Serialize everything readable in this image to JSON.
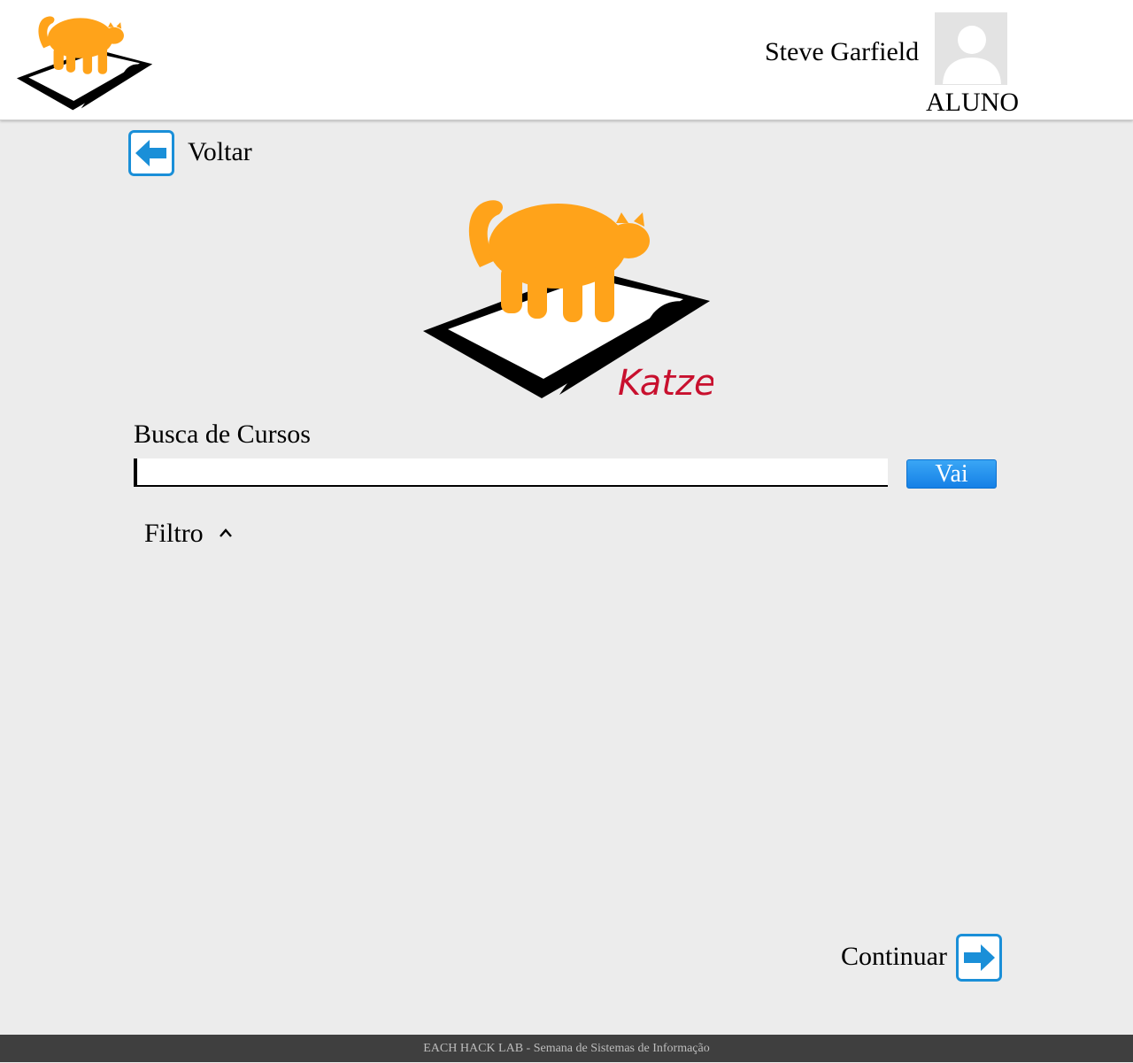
{
  "header": {
    "user_name": "Steve Garfield",
    "user_role": "ALUNO"
  },
  "navigation": {
    "back_label": "Voltar",
    "continue_label": "Continuar"
  },
  "logo": {
    "brand_text": "Katze"
  },
  "search": {
    "label": "Busca de Cursos",
    "value": "",
    "placeholder": "",
    "button_label": "Vai"
  },
  "filter": {
    "label": "Filtro",
    "state": "expanded"
  },
  "footer": {
    "text": "EACH HACK LAB - Semana de Sistemas de Informação"
  },
  "colors": {
    "accent_blue": "#1a8fd8",
    "cat_orange": "#ffa31a",
    "brand_red": "#c8102e",
    "background": "#ececec",
    "footer_bg": "#3f3f3f"
  },
  "icons": {
    "back": "arrow-left-icon",
    "continue": "arrow-right-icon",
    "filter": "chevron-up-icon",
    "avatar": "user-silhouette-icon"
  }
}
